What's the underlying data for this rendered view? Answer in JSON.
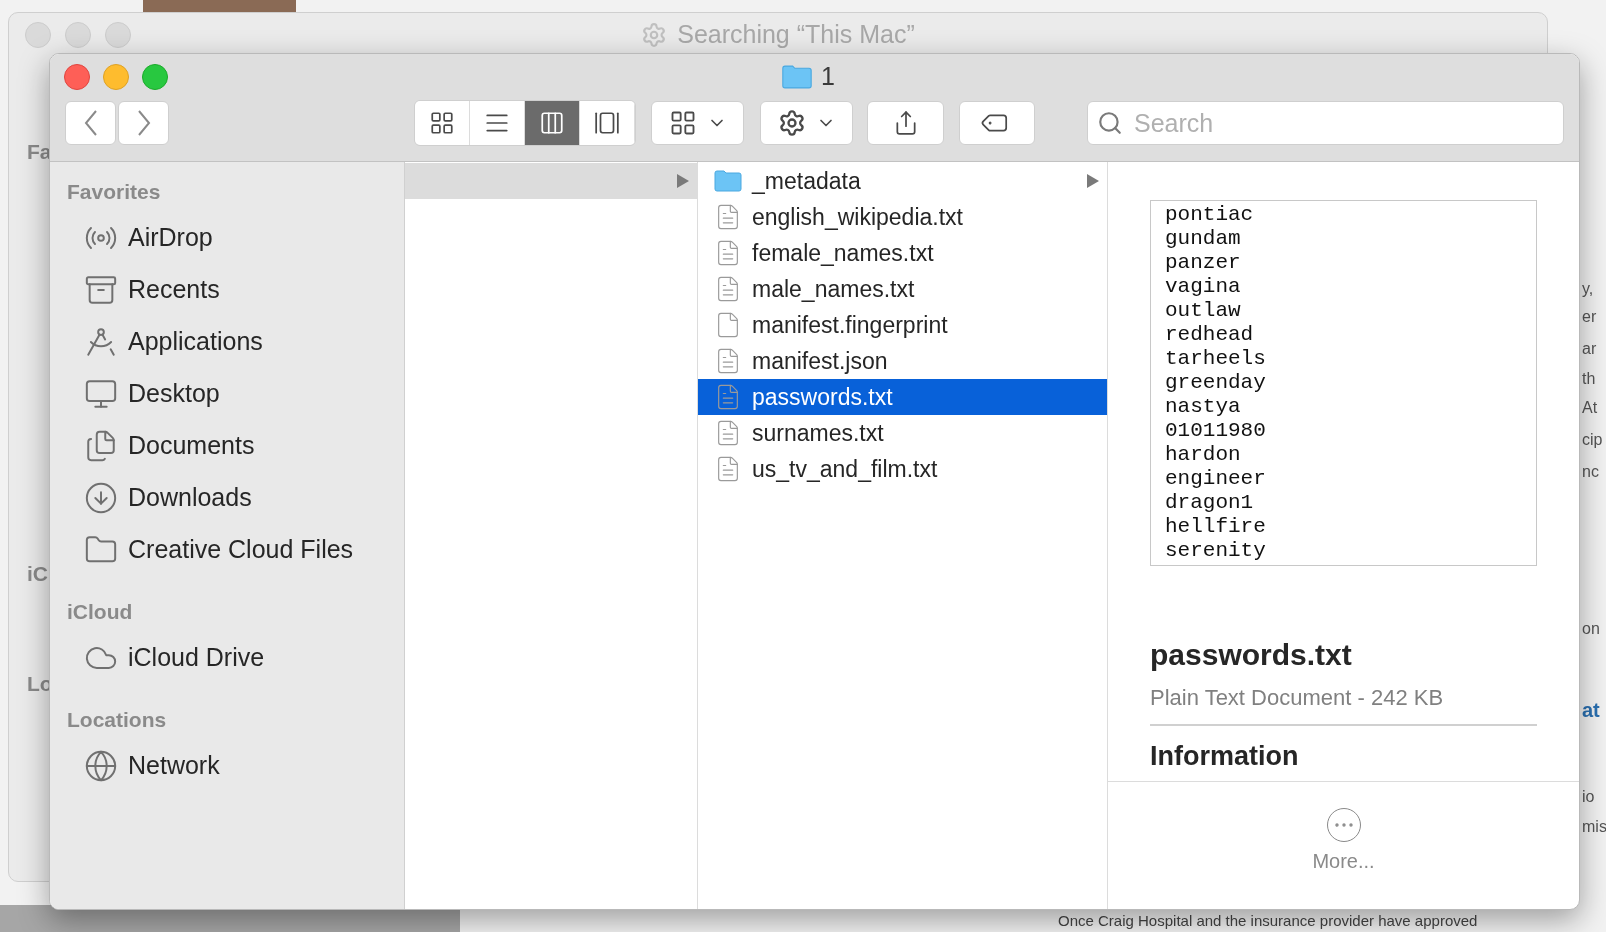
{
  "back_window": {
    "title": "Searching “This Mac”",
    "sidebar_fragments": [
      "Fa",
      "iC",
      "Lo"
    ]
  },
  "background_page": {
    "fragments": [
      {
        "text": "y,",
        "kind": "plain"
      },
      {
        "text": "er",
        "kind": "plain"
      },
      {
        "text": "ar",
        "kind": "plain"
      },
      {
        "text": "th",
        "kind": "plain"
      },
      {
        "text": "At",
        "kind": "plain"
      },
      {
        "text": "cip",
        "kind": "plain"
      },
      {
        "text": "nc",
        "kind": "plain"
      },
      {
        "text": "on",
        "kind": "plain"
      },
      {
        "text": "at",
        "kind": "heading"
      },
      {
        "text": "io",
        "kind": "plain"
      },
      {
        "text": "mis",
        "kind": "plain"
      }
    ],
    "bottom_text": "Once Craig Hospital and the insurance provider have approved"
  },
  "window": {
    "title": "1"
  },
  "toolbar": {
    "view_modes": [
      {
        "kind": "icons",
        "selected": false
      },
      {
        "kind": "list",
        "selected": false
      },
      {
        "kind": "columns",
        "selected": true
      },
      {
        "kind": "gallery",
        "selected": false
      }
    ],
    "search": {
      "placeholder": "Search"
    }
  },
  "sidebar": {
    "sections": [
      {
        "title": "Favorites",
        "items": [
          {
            "label": "AirDrop",
            "kind": "airdrop"
          },
          {
            "label": "Recents",
            "kind": "recents"
          },
          {
            "label": "Applications",
            "kind": "applications"
          },
          {
            "label": "Desktop",
            "kind": "desktop"
          },
          {
            "label": "Documents",
            "kind": "documents"
          },
          {
            "label": "Downloads",
            "kind": "downloads"
          },
          {
            "label": "Creative Cloud Files",
            "kind": "folder"
          }
        ]
      },
      {
        "title": "iCloud",
        "items": [
          {
            "label": "iCloud Drive",
            "kind": "cloud"
          }
        ]
      },
      {
        "title": "Locations",
        "items": [
          {
            "label": "Network",
            "kind": "network"
          }
        ]
      }
    ]
  },
  "column_1": {
    "rows": [
      {
        "selected": true,
        "expandable": true
      }
    ]
  },
  "column_2": {
    "rows": [
      {
        "name": "_metadata",
        "kind": "folder",
        "selected": false
      },
      {
        "name": "english_wikipedia.txt",
        "kind": "text",
        "selected": false
      },
      {
        "name": "female_names.txt",
        "kind": "text",
        "selected": false
      },
      {
        "name": "male_names.txt",
        "kind": "text",
        "selected": false
      },
      {
        "name": "manifest.fingerprint",
        "kind": "blank",
        "selected": false
      },
      {
        "name": "manifest.json",
        "kind": "text",
        "selected": false
      },
      {
        "name": "passwords.txt",
        "kind": "text",
        "selected": true
      },
      {
        "name": "surnames.txt",
        "kind": "text",
        "selected": false
      },
      {
        "name": "us_tv_and_film.txt",
        "kind": "text",
        "selected": false
      }
    ]
  },
  "preview": {
    "lines": [
      "pontiac",
      "gundam",
      "panzer",
      "vagina",
      "outlaw",
      "redhead",
      "tarheels",
      "greenday",
      "nastya",
      "01011980",
      "hardon",
      "engineer",
      "dragon1",
      "hellfire",
      "serenity"
    ],
    "file_name": "passwords.txt",
    "file_info": "Plain Text Document - 242 KB",
    "section_title": "Information",
    "more_label": "More..."
  }
}
